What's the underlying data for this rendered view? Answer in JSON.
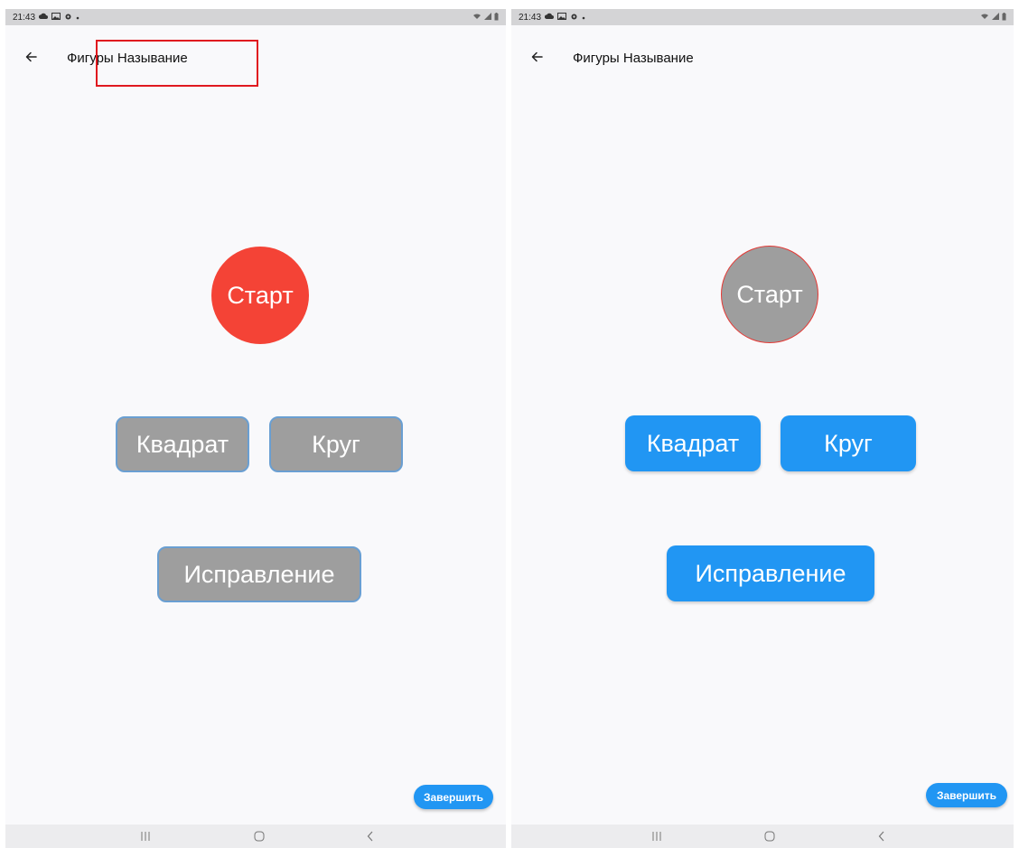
{
  "screens": [
    {
      "status": {
        "time": "21:43"
      },
      "appbar": {
        "title": "Фигуры Называние"
      },
      "start_label": "Старт",
      "options": {
        "square": "Квадрат",
        "circle": "Круг"
      },
      "fix_label": "Исправление",
      "finish_label": "Завершить"
    },
    {
      "status": {
        "time": "21:43"
      },
      "appbar": {
        "title": "Фигуры Называние"
      },
      "start_label": "Старт",
      "options": {
        "square": "Квадрат",
        "circle": "Круг"
      },
      "fix_label": "Исправление",
      "finish_label": "Завершить"
    }
  ],
  "colors": {
    "accent_blue": "#2196f3",
    "start_red": "#f44336",
    "inactive_gray": "#9e9e9e",
    "highlight_red": "#e0191f"
  },
  "icons": {
    "status_left": [
      "cloud-icon",
      "image-icon",
      "settings-icon",
      "dot-icon"
    ],
    "status_right": [
      "wifi-icon",
      "signal-icon",
      "battery-icon"
    ],
    "appbar": "arrow-back-icon",
    "navbar": [
      "recent-apps-icon",
      "home-icon",
      "nav-back-icon"
    ]
  }
}
